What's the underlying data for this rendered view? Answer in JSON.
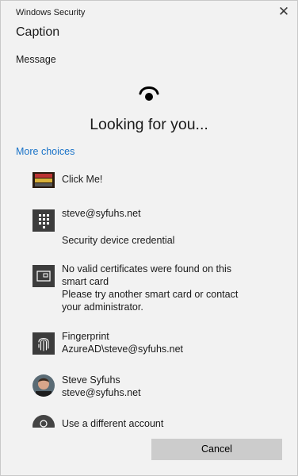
{
  "window": {
    "title": "Windows Security"
  },
  "caption": "Caption",
  "message": "Message",
  "status": "Looking for you...",
  "more_choices": "More choices",
  "options": {
    "click_me": {
      "label": "Click Me!"
    },
    "steve_pin": {
      "line1": "steve@syfuhs.net",
      "line2": "Security device credential"
    },
    "smart_card": {
      "line1": "No valid certificates were found on this",
      "line2": "smart card",
      "line3": "Please try another smart card or contact",
      "line4": "your administrator."
    },
    "fingerprint": {
      "line1": "Fingerprint",
      "line2": "AzureAD\\steve@syfuhs.net"
    },
    "steve_user": {
      "line1": "Steve Syfuhs",
      "line2": "steve@syfuhs.net"
    },
    "different": {
      "label": "Use a different account"
    }
  },
  "footer": {
    "cancel_label": "Cancel"
  },
  "icons": {
    "close": "close-icon",
    "face": "face-recognition-icon",
    "click_me": "click-me-image-icon",
    "pin": "keypad-icon",
    "smart_card": "smart-card-icon",
    "fingerprint": "fingerprint-icon",
    "avatar": "avatar",
    "person": "person-icon"
  },
  "colors": {
    "link": "#1a73c8",
    "button": "#cccccc",
    "icon_tile": "#3c3c3c"
  }
}
